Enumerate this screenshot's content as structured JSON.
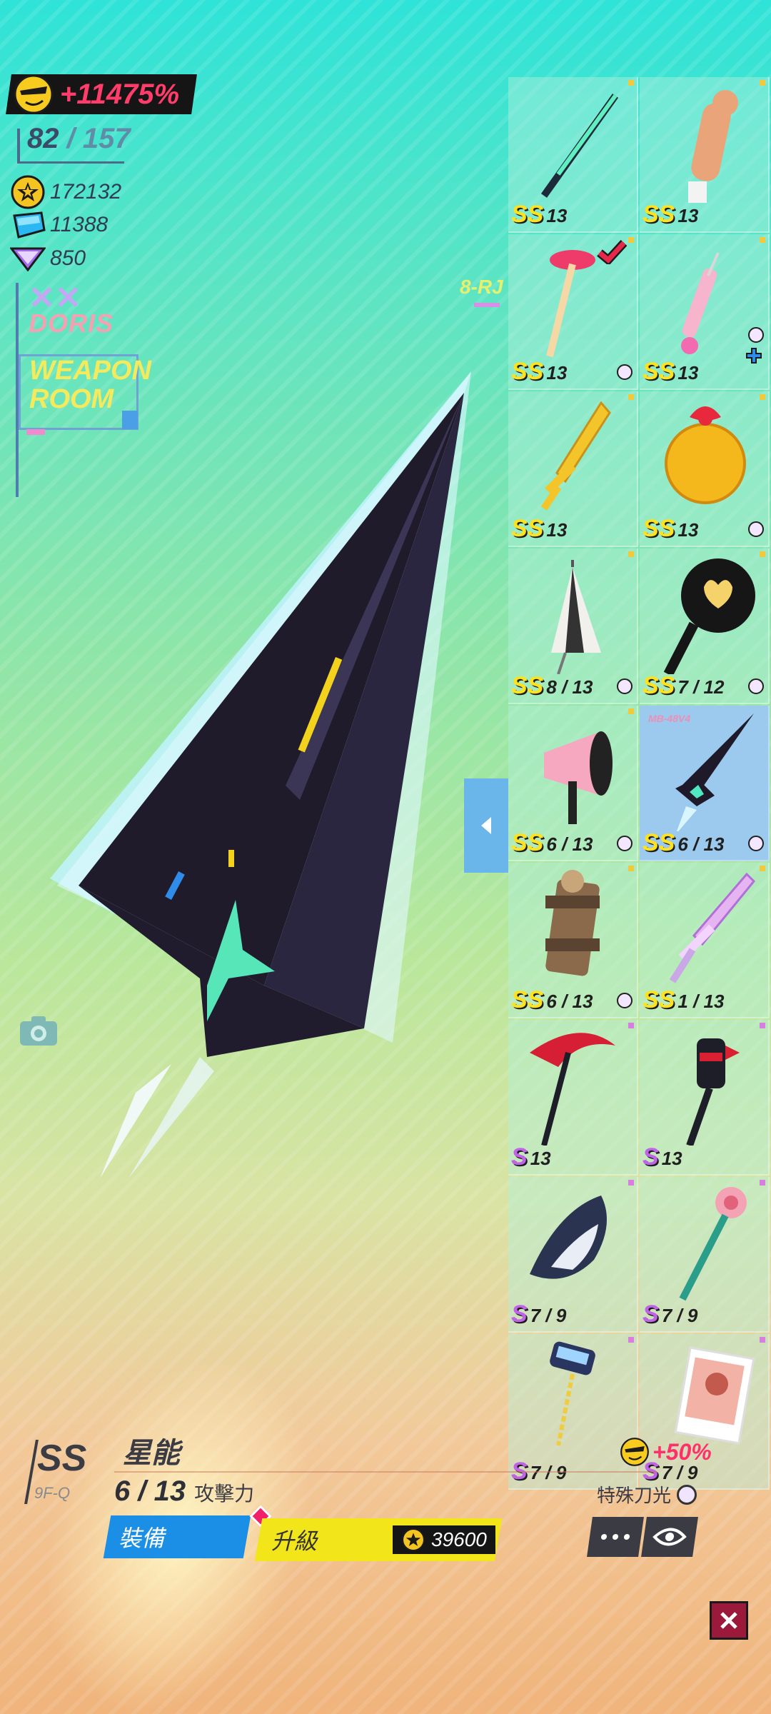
{
  "hud": {
    "boost_percent": "+11475%",
    "weapon_count": "82",
    "weapon_total": "157",
    "separator": "/",
    "gold": "172132",
    "gems": "11388",
    "crystals": "850",
    "character_name": "DORIS",
    "room_title_line1": "WEAPON",
    "room_title_line2": "ROOM",
    "zone_code": "8-RJ"
  },
  "inventory": [
    {
      "rank": "SS",
      "level": "13",
      "icon": "green-katana-icon",
      "dot": "yellow"
    },
    {
      "rank": "SS",
      "level": "13",
      "icon": "corgi-bat-icon",
      "dot": "yellow"
    },
    {
      "rank": "SS",
      "level": "13",
      "icon": "plunger-icon",
      "dot": "yellow",
      "equipped": true,
      "ring": true
    },
    {
      "rank": "SS",
      "level": "13",
      "icon": "syringe-icon",
      "dot": "yellow",
      "ring_top": true,
      "plus": true
    },
    {
      "rank": "SS",
      "level": "13",
      "icon": "gold-sword-icon",
      "dot": "yellow"
    },
    {
      "rank": "SS",
      "level": "13",
      "icon": "bell-icon",
      "dot": "yellow",
      "ring": true
    },
    {
      "rank": "SS",
      "level": "8 / 13",
      "icon": "umbrella-icon",
      "dot": "yellow",
      "ring": true
    },
    {
      "rank": "SS",
      "level": "7 / 12",
      "icon": "frying-pan-icon",
      "dot": "yellow",
      "ring": true
    },
    {
      "rank": "SS",
      "level": "6 / 13",
      "icon": "megaphone-icon",
      "dot": "yellow",
      "ring": true
    },
    {
      "rank": "SS",
      "level": "6 / 13",
      "icon": "star-spear-icon",
      "selected": true,
      "tag": "MB-48V4",
      "ring": true
    },
    {
      "rank": "SS",
      "level": "6 / 13",
      "icon": "mech-cannon-icon",
      "dot": "yellow",
      "ring": true
    },
    {
      "rank": "SS",
      "level": "1 / 13",
      "icon": "crystal-sword-icon",
      "dot": "yellow"
    },
    {
      "rank": "S",
      "level": "13",
      "icon": "red-scythe-icon",
      "dot": "pink"
    },
    {
      "rank": "S",
      "level": "13",
      "icon": "spiked-mace-icon",
      "dot": "pink"
    },
    {
      "rank": "S",
      "level": "7 / 9",
      "icon": "shark-icon",
      "dot": "pink"
    },
    {
      "rank": "S",
      "level": "7 / 9",
      "icon": "flower-staff-icon",
      "dot": "pink"
    },
    {
      "rank": "S",
      "level": "7 / 9",
      "icon": "phone-flail-icon",
      "dot": "pink"
    },
    {
      "rank": "S",
      "level": "7 / 9",
      "icon": "photo-card-icon",
      "dot": "pink"
    }
  ],
  "selected": {
    "rank": "SS",
    "code": "9F-Q",
    "name": "星能",
    "level": "6 / 13",
    "stat_label": "攻擊力",
    "bonus": "+50%",
    "special_label": "特殊刀光",
    "equip_label": "裝備",
    "upgrade_label": "升級",
    "upgrade_cost": "39600"
  },
  "colors": {
    "accent_pink": "#ff3c6a",
    "rank_ss": "#ffe21c",
    "rank_s": "#c063e8",
    "equip_blue": "#1b8fe6",
    "upgrade_yellow": "#f2e61a"
  }
}
